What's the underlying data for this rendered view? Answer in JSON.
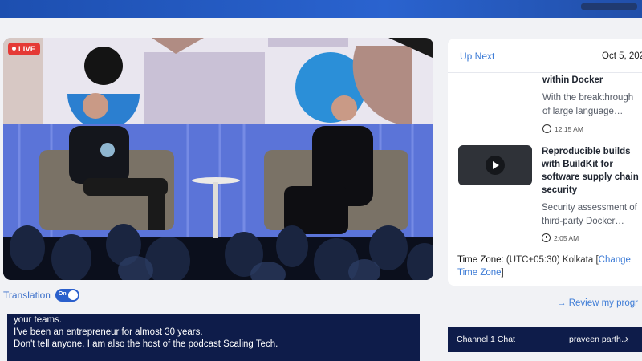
{
  "video": {
    "live_label": "LIVE"
  },
  "translation": {
    "label": "Translation",
    "toggle_state": "On"
  },
  "captions": {
    "lines": [
      "your teams.",
      "I've been an entrepreneur for almost 30 years.",
      "Don't tell anyone. I am also the host of the podcast Scaling Tech."
    ]
  },
  "sidebar": {
    "up_next": "Up Next",
    "date": "Oct 5, 202",
    "items": [
      {
        "title": "within Docker",
        "desc_lines": [
          "With the breakthrough",
          "of large language…"
        ],
        "time": "12:15 AM"
      },
      {
        "title_lines": [
          "Reproducible builds",
          "with BuildKit for",
          "software supply chain",
          "security"
        ],
        "desc_lines": [
          "Security assessment of",
          "third-party Docker…"
        ],
        "time": "2:05 AM"
      }
    ],
    "timezone": {
      "label": "Time Zone",
      "value": ": (UTC+05:30) Kolkata [",
      "change_link": "Change Time Zone",
      "close": "]"
    }
  },
  "review_link": "→ Review my progr",
  "chat": {
    "channel": "Channel 1 Chat",
    "user": "praveen parth…",
    "chevron": "›"
  },
  "colors": {
    "accent": "#3c7bd6",
    "live": "#e53935",
    "caption_bg": "#0e1c4a",
    "toggle": "#2a5fcc"
  }
}
